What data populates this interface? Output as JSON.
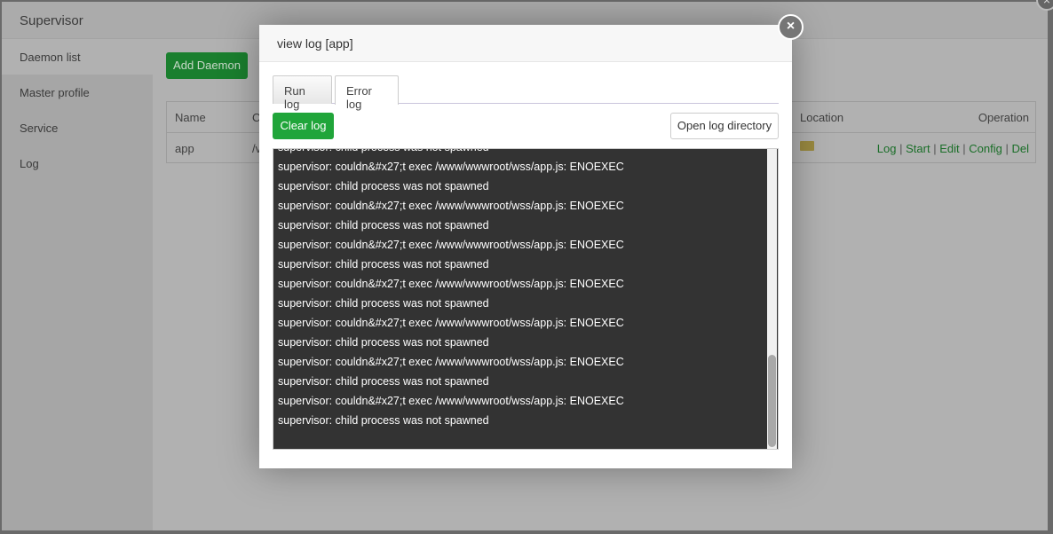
{
  "app": {
    "title": "Supervisor",
    "sidebar": [
      "Daemon list",
      "Master profile",
      "Service",
      "Log"
    ],
    "add_button": "Add Daemon",
    "table": {
      "headers": {
        "name": "Name",
        "col2": "C",
        "location": "Location",
        "operation": "Operation"
      },
      "row": {
        "name": "app",
        "col2": "/v",
        "ops": [
          "Log",
          "Start",
          "Edit",
          "Config",
          "Del"
        ],
        "sep": "|"
      }
    }
  },
  "modal": {
    "title": "view log [app]",
    "tabs": [
      "Run log",
      "Error log"
    ],
    "active_tab": "Error log",
    "clear_button": "Clear log",
    "open_dir_button": "Open log directory",
    "log_lines": [
      "supervisor: child process was not spawned",
      "supervisor: couldn&#x27;t exec /www/wwwroot/wss/app.js: ENOEXEC",
      "supervisor: child process was not spawned",
      "supervisor: couldn&#x27;t exec /www/wwwroot/wss/app.js: ENOEXEC",
      "supervisor: child process was not spawned",
      "supervisor: couldn&#x27;t exec /www/wwwroot/wss/app.js: ENOEXEC",
      "supervisor: child process was not spawned",
      "supervisor: couldn&#x27;t exec /www/wwwroot/wss/app.js: ENOEXEC",
      "supervisor: child process was not spawned",
      "supervisor: couldn&#x27;t exec /www/wwwroot/wss/app.js: ENOEXEC",
      "supervisor: child process was not spawned",
      "supervisor: couldn&#x27;t exec /www/wwwroot/wss/app.js: ENOEXEC",
      "supervisor: child process was not spawned",
      "supervisor: couldn&#x27;t exec /www/wwwroot/wss/app.js: ENOEXEC",
      "supervisor: child process was not spawned"
    ],
    "close_icon": "×"
  }
}
